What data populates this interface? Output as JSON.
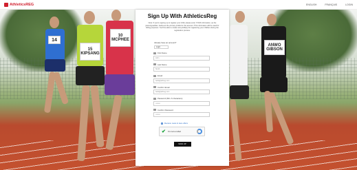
{
  "header": {
    "logo_text": "AthleticsREG",
    "nav": [
      "ENGLISH",
      "FRANÇAIS",
      "LOGIN"
    ]
  },
  "modal": {
    "title": "Sign Up With AthleticsReg",
    "intro": "Note: If you're signing up to register your child, please enter YOUR information, as the parent/guardian, below as the primary profile for the account. This information will be used for billing purposes. You'll be able to create sub-profile(s) for registering your children during the registration process.",
    "question_label": "Already have an account?",
    "question_value": "Login",
    "fields": [
      {
        "label": "First Name",
        "value": "John"
      },
      {
        "label": "Last Name",
        "value": "Smith"
      },
      {
        "label": "Email",
        "value": "hello@athreg.com"
      },
      {
        "label": "Confirm Email",
        "value": "hello@athreg.com"
      },
      {
        "label": "Password (Min. 6 characters)",
        "value": "••••••••"
      },
      {
        "label": "Confirm Password",
        "value": "••••••••"
      }
    ],
    "opt_in_label": "Receive news & race offers",
    "captcha_label": "I'm not a robot",
    "submit_label": "SIGN UP"
  },
  "runners": [
    {
      "bib": "14",
      "singlet": "#2f6fd1",
      "shorts": "#1c2f6a"
    },
    {
      "bib": "15\nKIPSANG",
      "singlet": "#b6d63a",
      "shorts": "#222222"
    },
    {
      "bib": "10\nMCPHEE",
      "singlet": "#d8334a",
      "shorts": "#6a3d9a"
    },
    {
      "bib": "ANWO\nGIBSON",
      "singlet": "#1a1a1a",
      "shorts": "#1a1a1a"
    },
    {
      "bib": "",
      "singlet": "#ffffff",
      "shorts": "#222222"
    }
  ]
}
